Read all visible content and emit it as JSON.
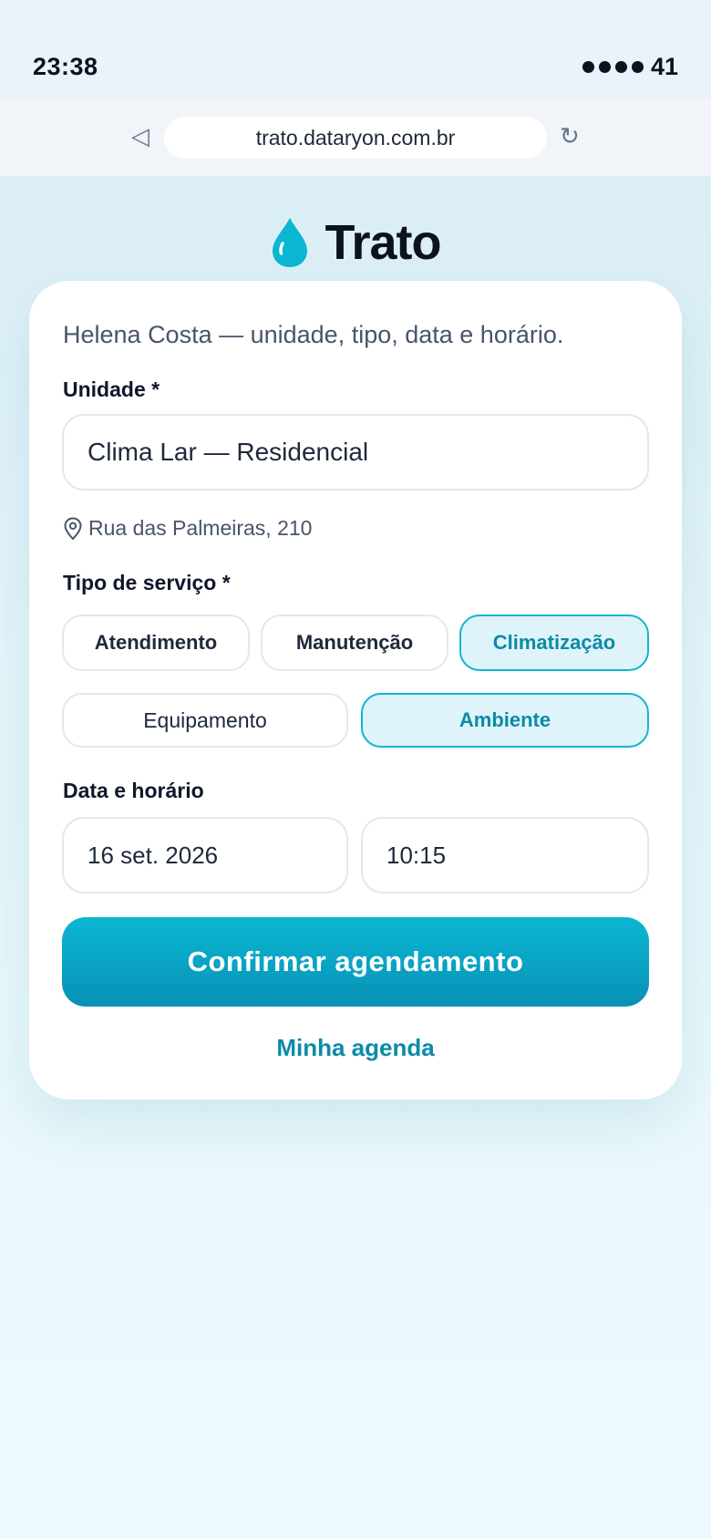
{
  "status": {
    "time": "23:38",
    "battery": "41"
  },
  "browser": {
    "url": "trato.dataryon.com.br"
  },
  "brand": {
    "name": "Trato",
    "accent": "#0bb7d3"
  },
  "form": {
    "subtitle": "Helena Costa — unidade, tipo, data e horário.",
    "unit_label": "Unidade *",
    "unit_value": "Clima Lar — Residencial",
    "address": "Rua das Palmeiras, 210",
    "service_label": "Tipo de serviço *",
    "services": [
      {
        "label": "Atendimento",
        "selected": false
      },
      {
        "label": "Manutenção",
        "selected": false
      },
      {
        "label": "Climatização",
        "selected": true
      },
      {
        "label": "Equipamento",
        "selected": false
      },
      {
        "label": "Ambiente",
        "selected": true
      }
    ],
    "datetime_label": "Data e horário",
    "date_value": "16 set. 2026",
    "time_value": "10:15",
    "confirm_label": "Confirmar agendamento",
    "agenda_link": "Minha agenda"
  }
}
